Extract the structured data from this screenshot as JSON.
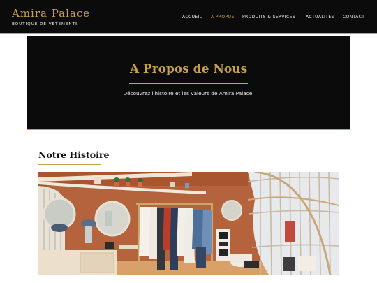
{
  "brand": {
    "name": "Amira Palace",
    "tagline": "BOUTIQUE DE VÊTEMENTS"
  },
  "nav": {
    "items": [
      {
        "label": "ACCUEIL"
      },
      {
        "label": "A PROPOS"
      },
      {
        "label": "PRODUITS & SERVICES"
      },
      {
        "label": "ACTUALITÉS"
      },
      {
        "label": "CONTACT"
      }
    ],
    "active": "A PROPOS"
  },
  "hero": {
    "title": "A Propos de Nous",
    "subtitle": "Découvrez l'histoire et les valeurs de Amira Palace."
  },
  "section": {
    "title": "Notre Histoire"
  },
  "colors": {
    "accent": "#c8a14a",
    "dark": "#0b0b0b",
    "text_light": "#f2f2f2"
  }
}
